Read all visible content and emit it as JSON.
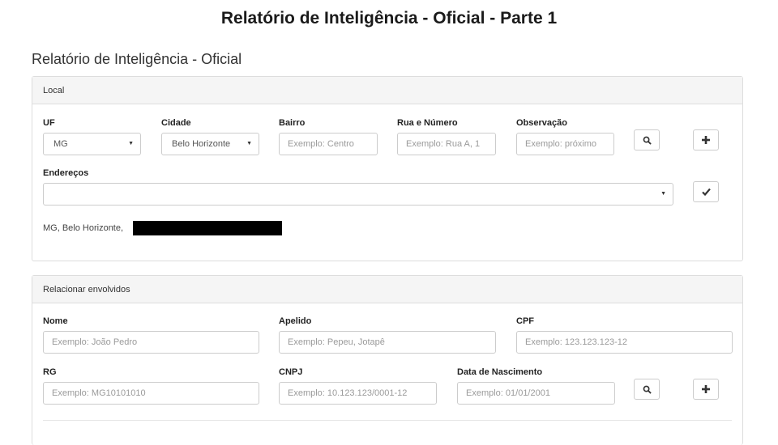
{
  "slide_title": "Relatório de Inteligência - Oficial - Parte 1",
  "page_heading": "Relatório de Inteligência - Oficial",
  "local": {
    "panel_title": "Local",
    "uf_label": "UF",
    "uf_value": "MG",
    "cidade_label": "Cidade",
    "cidade_value": "Belo Horizonte",
    "bairro_label": "Bairro",
    "bairro_placeholder": "Exemplo: Centro",
    "rua_label": "Rua e Número",
    "rua_placeholder": "Exemplo: Rua A, 1",
    "obs_label": "Observação",
    "obs_placeholder": "Exemplo: próximo",
    "enderecos_label": "Endereços",
    "enderecos_value": "",
    "address_text": "MG, Belo Horizonte,"
  },
  "envolvidos": {
    "panel_title": "Relacionar envolvidos",
    "nome_label": "Nome",
    "nome_placeholder": "Exemplo: João Pedro",
    "apelido_label": "Apelido",
    "apelido_placeholder": "Exemplo: Pepeu, Jotapê",
    "cpf_label": "CPF",
    "cpf_placeholder": "Exemplo: 123.123.123-12",
    "rg_label": "RG",
    "rg_placeholder": "Exemplo: MG10101010",
    "cnpj_label": "CNPJ",
    "cnpj_placeholder": "Exemplo: 10.123.123/0001-12",
    "nasc_label": "Data de Nascimento",
    "nasc_placeholder": "Exemplo: 01/01/2001"
  },
  "icons": {
    "search": "search-icon",
    "add": "plus-icon",
    "confirm": "check-icon",
    "dropdown": "caret-down-icon"
  }
}
